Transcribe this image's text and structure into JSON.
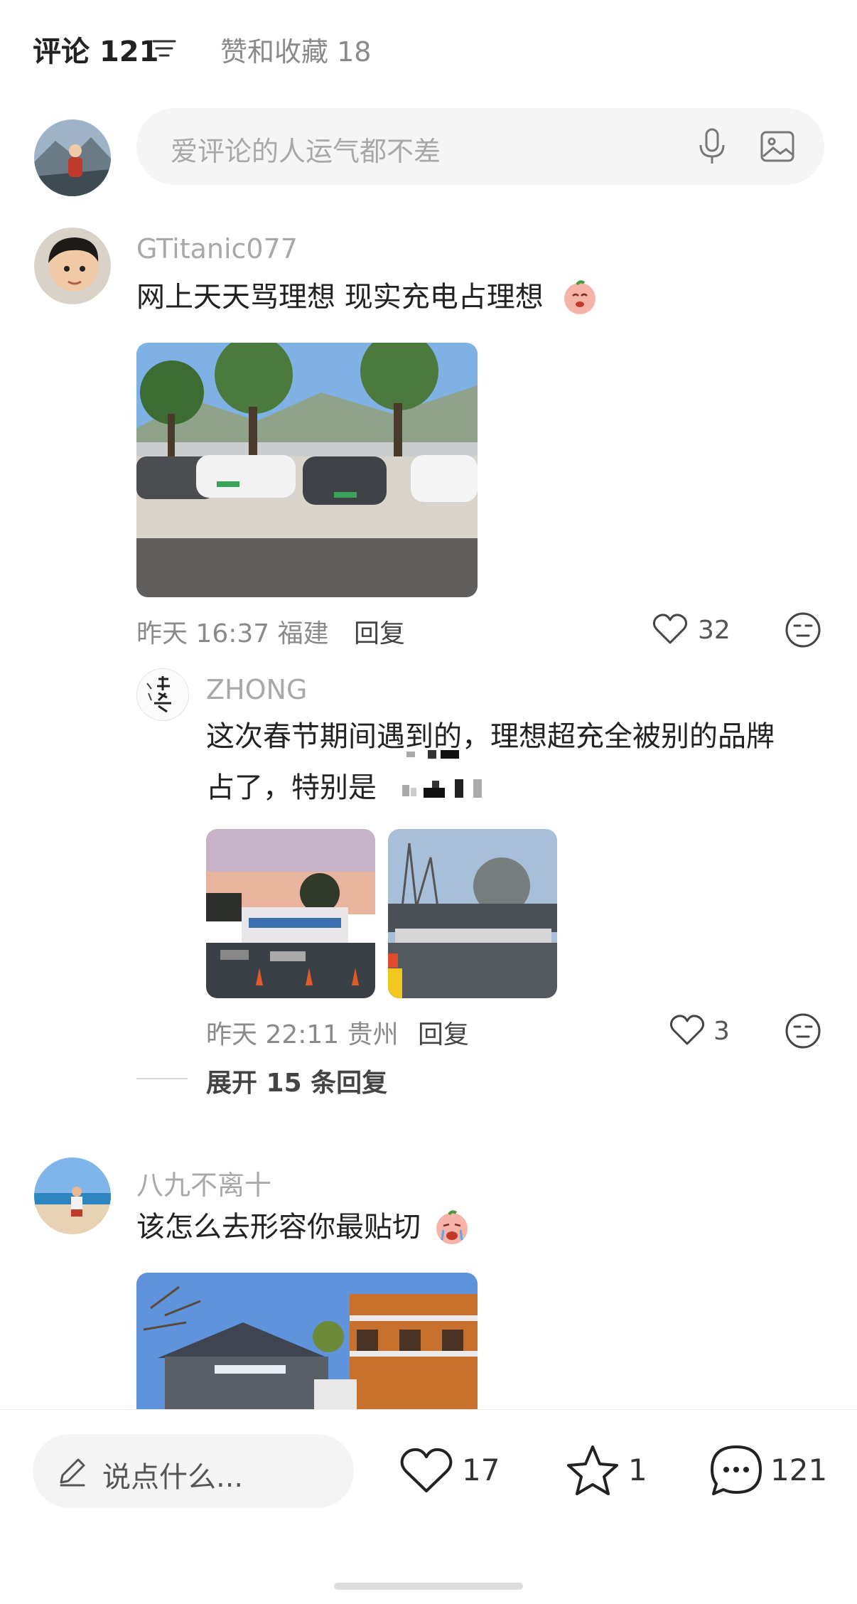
{
  "header": {
    "tab_comments_label": "评论",
    "tab_comments_count": "121",
    "tab_likes_label": "赞和收藏 18"
  },
  "comment_box": {
    "placeholder": "爱评论的人运气都不差"
  },
  "comments": [
    {
      "username": "GTitanic077",
      "text": "网上天天骂理想 现实充电占理想",
      "time_location": "昨天 16:37 福建",
      "reply_label": "回复",
      "likes": "32",
      "replies": [
        {
          "username": "ZHONG",
          "text_line1": "这次春节期间遇到的，理想超充全被别的品牌",
          "text_line2": "占了，特别是",
          "time_location": "昨天 22:11 贵州",
          "reply_label": "回复",
          "likes": "3"
        }
      ],
      "expand_label": "展开 15 条回复"
    },
    {
      "username": "八九不离十",
      "text": "该怎么去形容你最贴切"
    }
  ],
  "bottom_bar": {
    "compose_label": "说点什么...",
    "likes": "17",
    "favorites": "1",
    "comments": "121"
  },
  "colors": {
    "text_primary": "#222222",
    "text_secondary": "#8a8a8a",
    "username": "#a8a8a8",
    "input_bg": "#f5f5f5"
  }
}
